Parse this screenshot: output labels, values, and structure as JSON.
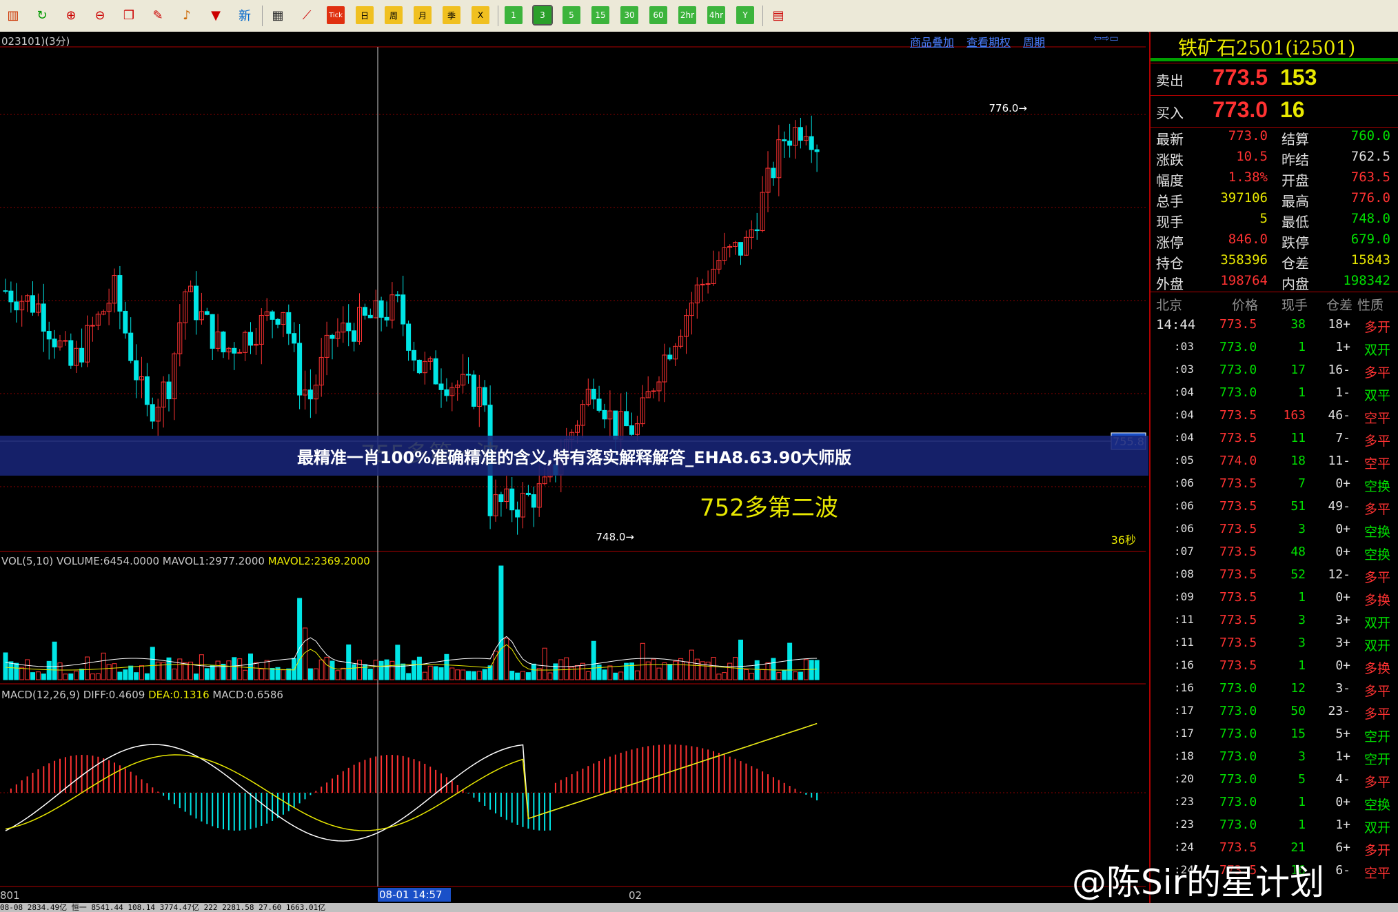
{
  "toolbar": {
    "buttons": [
      {
        "icon": "bars-icon",
        "label": "",
        "color": "#cc3300"
      },
      {
        "icon": "refresh-icon",
        "label": "",
        "color": "#009900"
      },
      {
        "icon": "zoom-in-icon",
        "label": "",
        "color": "#cc0000"
      },
      {
        "icon": "zoom-out-icon",
        "label": "",
        "color": "#cc0000"
      },
      {
        "icon": "window-icon",
        "label": "",
        "color": "#cc0000"
      },
      {
        "icon": "pen-icon",
        "label": "",
        "color": "#cc0000"
      },
      {
        "icon": "bell-icon",
        "label": "",
        "color": "#cc6600"
      },
      {
        "icon": "filter-icon",
        "label": "",
        "color": "#cc0000"
      },
      {
        "icon": "new-icon",
        "label": "新",
        "color": "#0066cc"
      },
      {
        "icon": "table-icon",
        "label": "",
        "color": "#333333"
      },
      {
        "icon": "line-chart-icon",
        "label": "",
        "color": "#cc0000"
      },
      {
        "icon": "tick-icon",
        "label": "Tick",
        "color": "#ffffff"
      },
      {
        "icon": "day-icon",
        "label": "日",
        "color": "#000000"
      },
      {
        "icon": "week-icon",
        "label": "周",
        "color": "#000000"
      },
      {
        "icon": "month-icon",
        "label": "月",
        "color": "#000000"
      },
      {
        "icon": "season-icon",
        "label": "季",
        "color": "#000000"
      },
      {
        "icon": "cross-icon",
        "label": "X",
        "color": "#000000"
      },
      {
        "icon": "min1-icon",
        "label": "1",
        "color": "#ffffff"
      },
      {
        "icon": "min3-icon",
        "label": "3",
        "color": "#ffffff"
      },
      {
        "icon": "min5-icon",
        "label": "5",
        "color": "#ffffff"
      },
      {
        "icon": "min15-icon",
        "label": "15",
        "color": "#ffffff"
      },
      {
        "icon": "min30-icon",
        "label": "30",
        "color": "#ffffff"
      },
      {
        "icon": "min60-icon",
        "label": "60",
        "color": "#ffffff"
      },
      {
        "icon": "h2-icon",
        "label": "2hr",
        "color": "#ffffff"
      },
      {
        "icon": "h4-icon",
        "label": "4hr",
        "color": "#ffffff"
      },
      {
        "icon": "year-icon",
        "label": "Y",
        "color": "#ffffff"
      },
      {
        "icon": "menu-icon",
        "label": "",
        "color": "#cc0000"
      }
    ]
  },
  "chart": {
    "header_title": "023101)(3分)",
    "links": [
      "商品叠加",
      "查看期权",
      "周期"
    ],
    "price_high_label": "776.0→",
    "price_low_label": "748.0→",
    "crosshair_price": "755.8",
    "wave1_label": "755多第一波",
    "wave2_label": "752多第二波",
    "countdown": "36秒",
    "vol_header": {
      "prefix": "VOL(5,10) VOLUME:6454.0000 MAVOL1:2977.2000 ",
      "mavol2": "MAVOL2:2369.2000"
    },
    "macd_header": {
      "prefix": "MACD(12,26,9) DIFF:0.4609 ",
      "dea": "DEA:0.1316",
      "suffix": " MACD:0.6586"
    },
    "x_labels": [
      "801",
      "08-01 14:57",
      "02"
    ],
    "colors": {
      "up": "#ff3232",
      "down": "#00e5e5",
      "grid": "#8b0000",
      "yellow": "#e8e800",
      "white": "#ffffff"
    }
  },
  "quote": {
    "instrument": "铁矿石2501(i2501)",
    "ask": {
      "label": "卖出",
      "price": "773.5",
      "vol": "153"
    },
    "bid": {
      "label": "买入",
      "price": "773.0",
      "vol": "16"
    },
    "stats": [
      [
        "最新",
        "773.0",
        "结算",
        "760.0"
      ],
      [
        "涨跌",
        "10.5",
        "昨结",
        "762.5"
      ],
      [
        "幅度",
        "1.38%",
        "开盘",
        "763.5"
      ],
      [
        "总手",
        "397106",
        "最高",
        "776.0"
      ],
      [
        "现手",
        "5",
        "最低",
        "748.0"
      ],
      [
        "涨停",
        "846.0",
        "跌停",
        "679.0"
      ],
      [
        "持仓",
        "358396",
        "仓差",
        "15843"
      ],
      [
        "外盘",
        "198764",
        "内盘",
        "198342"
      ]
    ],
    "tick_header": [
      "北京",
      "价格",
      "现手",
      "仓差",
      "性质"
    ],
    "ticks": [
      [
        "14:44",
        "773.5",
        "38",
        "+18",
        "多开"
      ],
      [
        ":03",
        "773.0",
        "1",
        "+1",
        "双开"
      ],
      [
        ":03",
        "773.0",
        "17",
        "-16",
        "多平"
      ],
      [
        ":04",
        "773.0",
        "1",
        "-1",
        "双平"
      ],
      [
        ":04",
        "773.5",
        "163",
        "-46",
        "空平"
      ],
      [
        ":04",
        "773.5",
        "11",
        "-7",
        "多平"
      ],
      [
        ":05",
        "774.0",
        "18",
        "-11",
        "空平"
      ],
      [
        ":06",
        "773.5",
        "7",
        "+0",
        "空换"
      ],
      [
        ":06",
        "773.5",
        "51",
        "-49",
        "多平"
      ],
      [
        ":06",
        "773.5",
        "3",
        "+0",
        "空换"
      ],
      [
        ":07",
        "773.5",
        "48",
        "+0",
        "空换"
      ],
      [
        ":08",
        "773.5",
        "52",
        "-12",
        "多平"
      ],
      [
        ":09",
        "773.5",
        "1",
        "+0",
        "多换"
      ],
      [
        ":11",
        "773.5",
        "3",
        "+3",
        "双开"
      ],
      [
        ":11",
        "773.5",
        "3",
        "+3",
        "双开"
      ],
      [
        ":16",
        "773.5",
        "1",
        "+0",
        "多换"
      ],
      [
        ":16",
        "773.0",
        "12",
        "-3",
        "多平"
      ],
      [
        ":17",
        "773.0",
        "50",
        "-23",
        "多平"
      ],
      [
        ":17",
        "773.0",
        "15",
        "+5",
        "空开"
      ],
      [
        ":18",
        "773.0",
        "3",
        "+1",
        "空开"
      ],
      [
        ":20",
        "773.0",
        "5",
        "-4",
        "多平"
      ],
      [
        ":23",
        "773.0",
        "1",
        "+0",
        "空换"
      ],
      [
        ":23",
        "773.0",
        "1",
        "+1",
        "双开"
      ],
      [
        ":24",
        "773.5",
        "21",
        "+6",
        "多开"
      ],
      [
        ":24",
        "773.5",
        "16",
        "-6",
        "空平"
      ]
    ]
  },
  "status": {
    "text": "08-08  2834.49亿   恒一  8541.44    108.14  3774.47亿    222  2281.58     27.60  1663.01亿"
  },
  "overlay": {
    "banner": "最精准一肖100%准确精准的含义,特有落实解释解答_EHA8.63.90大师版",
    "watermark": "@陈Sir的星计划"
  }
}
